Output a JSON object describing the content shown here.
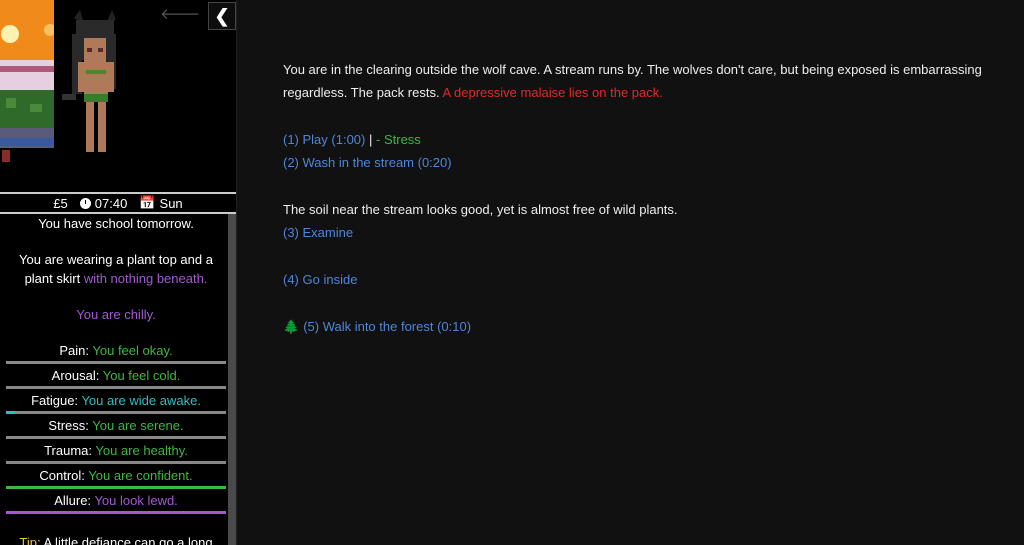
{
  "hud": {
    "money": "£5",
    "time": "07:40",
    "day": "Sun"
  },
  "sidebar": {
    "school_notice": "You have school tomorrow.",
    "clothing_prefix": "You are wearing a plant top and a plant skirt",
    "clothing_suffix": "with nothing beneath.",
    "temperature": "You are chilly.",
    "stats": [
      {
        "label": "Pain:",
        "value": "You feel okay.",
        "color": "#3eb83e",
        "bar_color": "#888888",
        "level": 0
      },
      {
        "label": "Arousal:",
        "value": "You feel cold.",
        "color": "#3eb83e",
        "bar_color": "#888888",
        "level": 0
      },
      {
        "label": "Fatigue:",
        "value": "You are wide awake.",
        "color": "#2fbfbf",
        "bar_color": "#888888",
        "level": 0.04
      },
      {
        "label": "Stress:",
        "value": "You are serene.",
        "color": "#3eb83e",
        "bar_color": "#888888",
        "level": 0
      },
      {
        "label": "Trauma:",
        "value": "You are healthy.",
        "color": "#3eb83e",
        "bar_color": "#888888",
        "level": 0
      },
      {
        "label": "Control:",
        "value": "You are confident.",
        "color": "#3eb83e",
        "bar_color": "#3eb83e",
        "level": 1
      },
      {
        "label": "Allure:",
        "value": "You look lewd.",
        "color": "#a25ad1",
        "bar_color": "#a25ad1",
        "level": 1
      }
    ],
    "tip_label": "Tip:",
    "tip_text": "A little defiance can go a long way."
  },
  "main": {
    "intro": "You are in the clearing outside the wolf cave. A stream runs by. The wolves don't care, but being exposed is embarrassing regardless. The pack rests.",
    "malaise": "A depressive malaise lies on the pack.",
    "play": "(1) Play (1:00)",
    "play_sep": "|",
    "play_effect": "- Stress",
    "wash": "(2) Wash in the stream (0:20)",
    "soil": "The soil near the stream looks good, yet is almost free of wild plants.",
    "examine": "(3) Examine",
    "inside": "(4) Go inside",
    "forest": "(5) Walk into the forest (0:10)"
  },
  "colors": {
    "link": "#4f86d8",
    "warning": "#e02a2a",
    "positive": "#3eb83e",
    "lewd": "#a25ad1",
    "tip": "#e8c34a"
  }
}
